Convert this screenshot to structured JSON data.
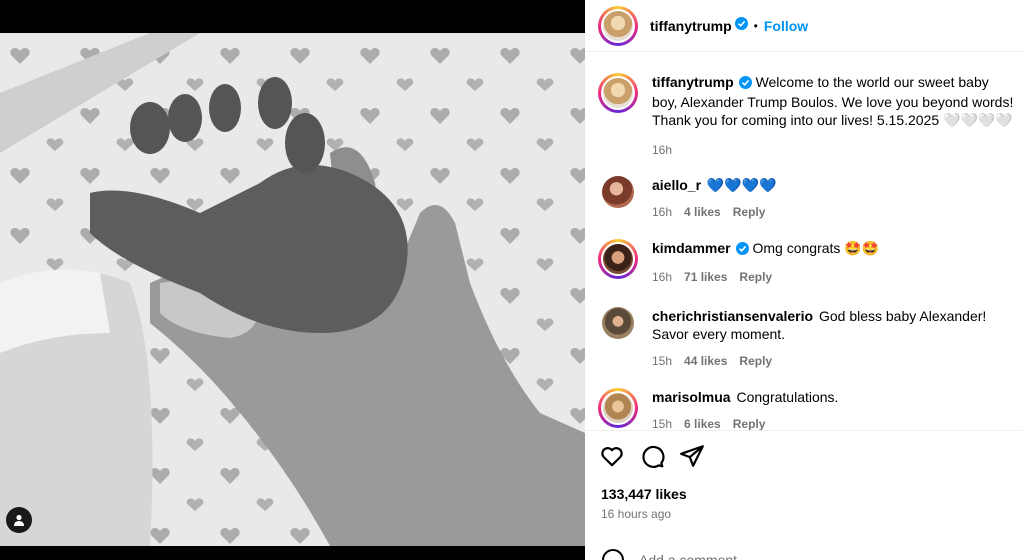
{
  "post": {
    "username": "tiffanytrump",
    "follow_label": "Follow",
    "dot": "•"
  },
  "caption": {
    "username": "tiffanytrump",
    "text": "Welcome to the world our sweet baby boy, Alexander Trump Boulos. We love you beyond words! Thank you for coming into our lives! 5.15.2025 🤍🤍🤍🤍",
    "time": "16h"
  },
  "comments": [
    {
      "username": "aiello_r",
      "text": "💙💙💙💙",
      "time": "16h",
      "likes": "4 likes",
      "reply": "Reply",
      "verified": false
    },
    {
      "username": "kimdammer",
      "text": "Omg congrats 🤩🤩",
      "time": "16h",
      "likes": "71 likes",
      "reply": "Reply",
      "verified": true
    },
    {
      "username": "cherichristiansenvalerio",
      "text": "God bless baby Alexander! Savor every moment.",
      "time": "15h",
      "likes": "44 likes",
      "reply": "Reply",
      "verified": false
    },
    {
      "username": "marisolmua",
      "text": "Congratulations.",
      "time": "15h",
      "likes": "6 likes",
      "reply": "Reply",
      "verified": false
    }
  ],
  "stats": {
    "likes": "133,447 likes",
    "posted": "16 hours ago"
  },
  "add_comment": {
    "placeholder": "Add a comment..."
  },
  "icons": {
    "like": "heart-icon",
    "comment": "comment-icon",
    "share": "share-icon",
    "emoji": "emoji-icon",
    "user_tag": "person-icon"
  },
  "colors": {
    "accent": "#0095f6",
    "verified": "#0095f6",
    "muted": "#737373"
  }
}
